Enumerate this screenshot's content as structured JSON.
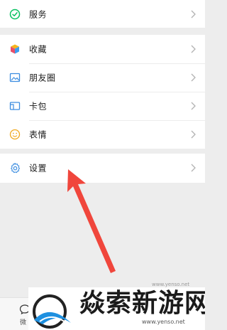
{
  "menu": {
    "services": {
      "label": "服务",
      "icon": "services-icon"
    },
    "favorites": {
      "label": "收藏",
      "icon": "favorites-cube-icon"
    },
    "moments": {
      "label": "朋友圈",
      "icon": "moments-image-icon"
    },
    "cards": {
      "label": "卡包",
      "icon": "card-wallet-icon"
    },
    "stickers": {
      "label": "表情",
      "icon": "smiley-icon"
    },
    "settings": {
      "label": "设置",
      "icon": "gear-icon"
    }
  },
  "tabbar": {
    "partial_label": "微"
  },
  "watermark": {
    "site_url_small": "www.yenso.net",
    "title": "焱索新游网",
    "url": "www.yenso.net"
  },
  "colors": {
    "background": "#ededed",
    "accent_green": "#07c160",
    "arrow_red": "#f0463c"
  }
}
